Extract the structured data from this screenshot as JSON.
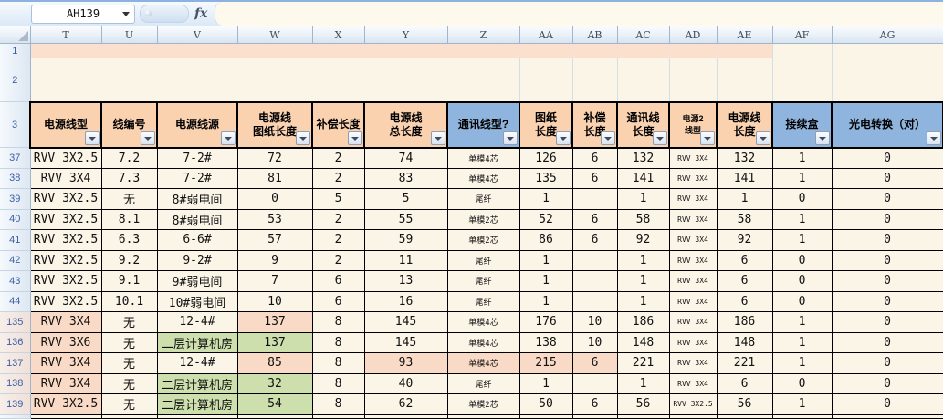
{
  "name_box": {
    "value": "AH139"
  },
  "formula_bar": {
    "fx": "fx",
    "value": ""
  },
  "colors": {
    "peach_band": "#FBE0CD",
    "header_peach": "#FAD2B0",
    "header_blue": "#8FB4DE",
    "salmon": "#F9DAC6",
    "green": "#CCDFAD",
    "sheet_bg": "#FBF5E8",
    "gridline": "#D5DDE9",
    "row_number": "#3B5EA9"
  },
  "columns": {
    "row_header_width": 33,
    "letters": [
      "T",
      "U",
      "V",
      "W",
      "X",
      "Y",
      "Z",
      "AA",
      "AB",
      "AC",
      "AD",
      "AE",
      "AF",
      "AG"
    ],
    "widths": [
      78,
      61,
      88,
      82,
      57,
      91,
      79,
      58,
      49,
      57,
      52,
      61,
      65,
      122
    ]
  },
  "pre_rows": {
    "row1_num": "1",
    "row2_num": "2",
    "row3_num": "3"
  },
  "headers": [
    {
      "col": "T",
      "lines": [
        "电源线型"
      ],
      "style": "peach",
      "small": false
    },
    {
      "col": "U",
      "lines": [
        "线编号"
      ],
      "style": "peach",
      "small": false
    },
    {
      "col": "V",
      "lines": [
        "电源线源"
      ],
      "style": "peach",
      "small": false
    },
    {
      "col": "W",
      "lines": [
        "电源线",
        "图纸长度"
      ],
      "style": "peach",
      "small": false
    },
    {
      "col": "X",
      "lines": [
        "补偿长度"
      ],
      "style": "peach",
      "small": false
    },
    {
      "col": "Y",
      "lines": [
        "电源线",
        "总长度"
      ],
      "style": "peach",
      "small": false
    },
    {
      "col": "Z",
      "lines": [
        "通讯线型?"
      ],
      "style": "blue",
      "small": false
    },
    {
      "col": "AA",
      "lines": [
        "图纸",
        "长度"
      ],
      "style": "peach",
      "small": false
    },
    {
      "col": "AB",
      "lines": [
        "补偿",
        "长度"
      ],
      "style": "peach",
      "small": false
    },
    {
      "col": "AC",
      "lines": [
        "通讯线",
        "长度"
      ],
      "style": "peach",
      "small": false
    },
    {
      "col": "AD",
      "lines": [
        "电源2",
        "线型"
      ],
      "style": "peach",
      "small": true
    },
    {
      "col": "AE",
      "lines": [
        "电源线",
        "长度"
      ],
      "style": "peach",
      "small": false
    },
    {
      "col": "AF",
      "lines": [
        "接续盒"
      ],
      "style": "blue",
      "small": false
    },
    {
      "col": "AG",
      "lines": [
        "光电转换（对）"
      ],
      "style": "blue",
      "small": false
    }
  ],
  "data_rows": [
    {
      "num": "37",
      "cells": [
        "RVV 3X2.5",
        "7.2",
        "7-2#",
        "72",
        "2",
        "74",
        "单模4芯",
        "126",
        "6",
        "132",
        "RVV 3X4",
        "132",
        "1",
        "0"
      ],
      "hl": {}
    },
    {
      "num": "38",
      "cells": [
        "RVV 3X4",
        "7.3",
        "7-2#",
        "81",
        "2",
        "83",
        "单模4芯",
        "135",
        "6",
        "141",
        "RVV 3X4",
        "141",
        "1",
        "0"
      ],
      "hl": {}
    },
    {
      "num": "39",
      "cells": [
        "RVV 3X2.5",
        "无",
        "8#弱电间",
        "0",
        "5",
        "5",
        "尾纤",
        "1",
        "",
        "1",
        "RVV 3X4",
        "1",
        "0",
        "0"
      ],
      "hl": {}
    },
    {
      "num": "40",
      "cells": [
        "RVV 3X2.5",
        "8.1",
        "8#弱电间",
        "53",
        "2",
        "55",
        "单模2芯",
        "52",
        "6",
        "58",
        "RVV 3X4",
        "58",
        "1",
        "0"
      ],
      "hl": {}
    },
    {
      "num": "41",
      "cells": [
        "RVV 3X2.5",
        "6.3",
        "6-6#",
        "57",
        "2",
        "59",
        "单模2芯",
        "86",
        "6",
        "92",
        "RVV 3X4",
        "92",
        "1",
        "0"
      ],
      "hl": {}
    },
    {
      "num": "42",
      "cells": [
        "RVV 3X2.5",
        "9.2",
        "9-2#",
        "9",
        "2",
        "11",
        "尾纤",
        "1",
        "",
        "1",
        "RVV 3X4",
        "6",
        "0",
        "0"
      ],
      "hl": {}
    },
    {
      "num": "43",
      "cells": [
        "RVV 3X2.5",
        "9.1",
        "9#弱电间",
        "7",
        "6",
        "13",
        "尾纤",
        "1",
        "",
        "1",
        "RVV 3X4",
        "6",
        "0",
        "0"
      ],
      "hl": {}
    },
    {
      "num": "44",
      "cells": [
        "RVV 3X2.5",
        "10.1",
        "10#弱电间",
        "10",
        "6",
        "16",
        "尾纤",
        "1",
        "",
        "1",
        "RVV 3X4",
        "6",
        "0",
        "0"
      ],
      "hl": {}
    },
    {
      "num": "135",
      "cells": [
        "RVV 3X4",
        "无",
        "12-4#",
        "137",
        "8",
        "145",
        "单模4芯",
        "176",
        "10",
        "186",
        "RVV 3X4",
        "186",
        "1",
        "0"
      ],
      "hl": {
        "0": "salmon",
        "3": "salmon"
      }
    },
    {
      "num": "136",
      "cells": [
        "RVV 3X6",
        "无",
        "二层计算机房",
        "137",
        "8",
        "145",
        "单模4芯",
        "138",
        "10",
        "148",
        "RVV 3X4",
        "148",
        "1",
        "0"
      ],
      "hl": {
        "0": "salmon",
        "2": "green",
        "3": "green"
      }
    },
    {
      "num": "137",
      "cells": [
        "RVV 3X4",
        "无",
        "12-4#",
        "85",
        "8",
        "93",
        "单模4芯",
        "215",
        "6",
        "221",
        "RVV 3X4",
        "221",
        "1",
        "0"
      ],
      "hl": {
        "0": "salmon",
        "3": "salmon",
        "5": "salmon",
        "6": "salmon",
        "7": "salmon",
        "8": "salmon"
      }
    },
    {
      "num": "138",
      "cells": [
        "RVV 3X4",
        "无",
        "二层计算机房",
        "32",
        "8",
        "40",
        "尾纤",
        "1",
        "",
        "1",
        "RVV 3X4",
        "6",
        "0",
        "0"
      ],
      "hl": {
        "0": "salmon",
        "2": "green",
        "3": "green"
      }
    },
    {
      "num": "139",
      "cells": [
        "RVV 3X2.5",
        "无",
        "二层计算机房",
        "54",
        "8",
        "62",
        "单模2芯",
        "50",
        "6",
        "56",
        "RVV 3X2.5",
        "56",
        "1",
        "0"
      ],
      "hl": {
        "0": "salmon",
        "2": "green",
        "3": "green"
      }
    }
  ]
}
